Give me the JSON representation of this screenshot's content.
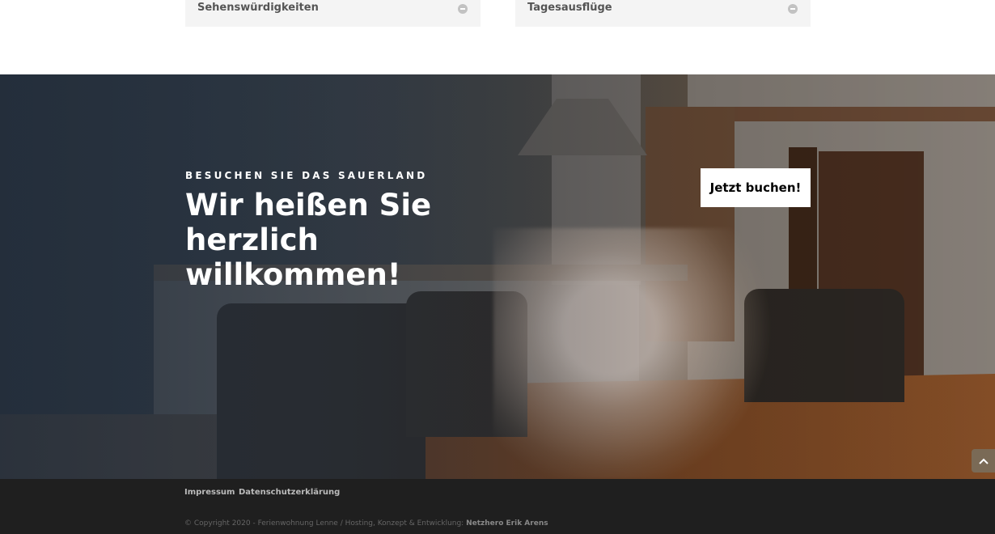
{
  "faq": {
    "items": [
      {
        "title": "Sehenswürdigkeiten"
      },
      {
        "title": "Tagesausflüge"
      }
    ]
  },
  "hero": {
    "subtitle": "BESUCHEN SIE DAS SAUERLAND",
    "title_lines": [
      "Wir heißen Sie",
      "herzlich",
      "willkommen!"
    ],
    "cta_label": "Jetzt buchen!"
  },
  "footer": {
    "links": [
      {
        "label": "Impressum"
      },
      {
        "label": "Datenschutzerklärung"
      }
    ],
    "copyright_text": "© Copyright 2020 - Ferienwohnung Lenne / Hosting, Konzept & Entwicklung: ",
    "copyright_company": "Netzhero Erik Arens"
  },
  "icons": {
    "toggle": "minus-circle-icon",
    "scroll_top": "chevron-up-icon"
  },
  "colors": {
    "toggle_bg": "#f4f4f4",
    "footer_bg": "#1f1f1f",
    "hero_overlay": "#232d3a",
    "button_bg": "#ffffff",
    "scroll_top_bg": "#7a6a56"
  }
}
